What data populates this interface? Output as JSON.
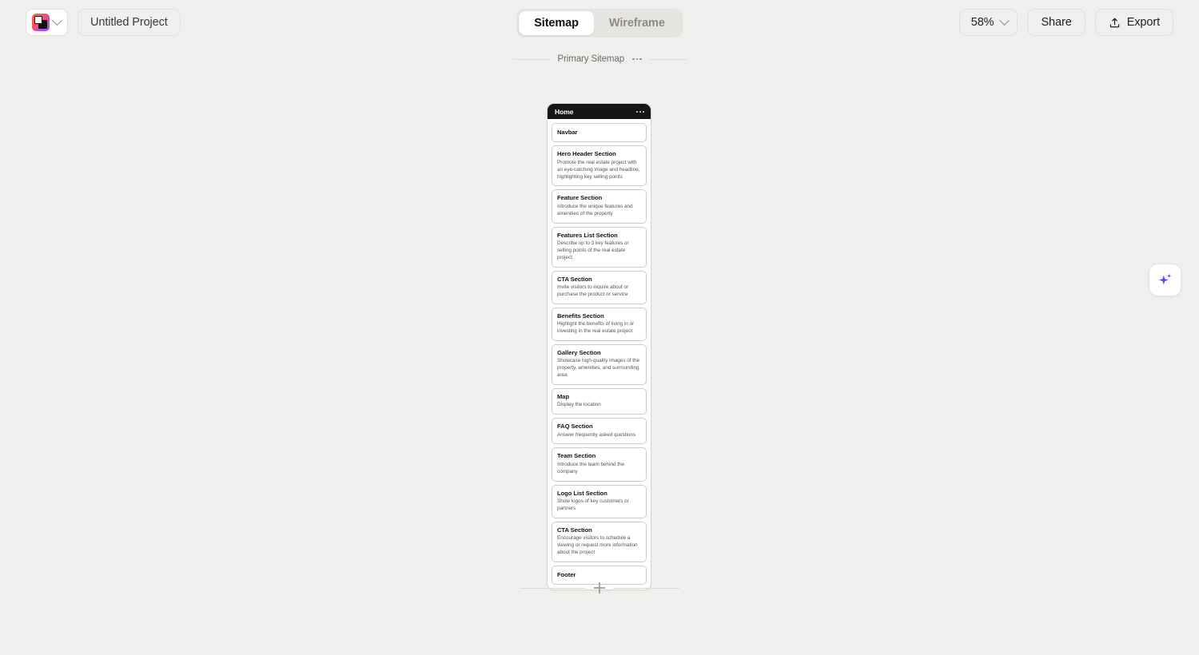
{
  "topbar": {
    "brand": {
      "icon": "app-logo-icon",
      "chevron": "chevron-down-icon"
    },
    "project_name": "Untitled Project",
    "view_tabs": [
      {
        "label": "Sitemap",
        "active": true
      },
      {
        "label": "Wireframe",
        "active": false
      }
    ],
    "zoom_level": "58%",
    "share_label": "Share",
    "export_label": "Export"
  },
  "canvas": {
    "group": {
      "title": "Primary Sitemap",
      "menu_icon": "more-horizontal-icon"
    },
    "page": {
      "title": "Home",
      "menu_icon": "more-horizontal-icon",
      "sections": [
        {
          "title": "Navbar",
          "desc": ""
        },
        {
          "title": "Hero Header Section",
          "desc": "Promote the real estate project with an eye-catching image and headline, highlighting key selling points"
        },
        {
          "title": "Feature Section",
          "desc": "Introduce the unique features and amenities of the property"
        },
        {
          "title": "Features List Section",
          "desc": "Describe up to 3 key features or selling points of the real estate project"
        },
        {
          "title": "CTA Section",
          "desc": "Invite visitors to inquire about or purchase the product or service"
        },
        {
          "title": "Benefits Section",
          "desc": "Highlight the benefits of living in or investing in the real estate project"
        },
        {
          "title": "Gallery Section",
          "desc": "Showcase high-quality images of the property, amenities, and surrounding area"
        },
        {
          "title": "Map",
          "desc": "Display the location"
        },
        {
          "title": "FAQ Section",
          "desc": "Answer frequently asked questions"
        },
        {
          "title": "Team Section",
          "desc": "Introduce the team behind the company"
        },
        {
          "title": "Logo List Section",
          "desc": "Show logos of key customers or partners"
        },
        {
          "title": "CTA Section",
          "desc": "Encourage visitors to schedule a viewing or request more information about the project"
        },
        {
          "title": "Footer",
          "desc": ""
        }
      ]
    },
    "add_page_icon": "plus-icon"
  },
  "ai_button": {
    "icon": "sparkles-icon",
    "color": "#5b42f3"
  },
  "colors": {
    "background": "#f1efed",
    "card_header": "#161616",
    "border": "#d8d5d1",
    "accent": "#5b42f3"
  }
}
